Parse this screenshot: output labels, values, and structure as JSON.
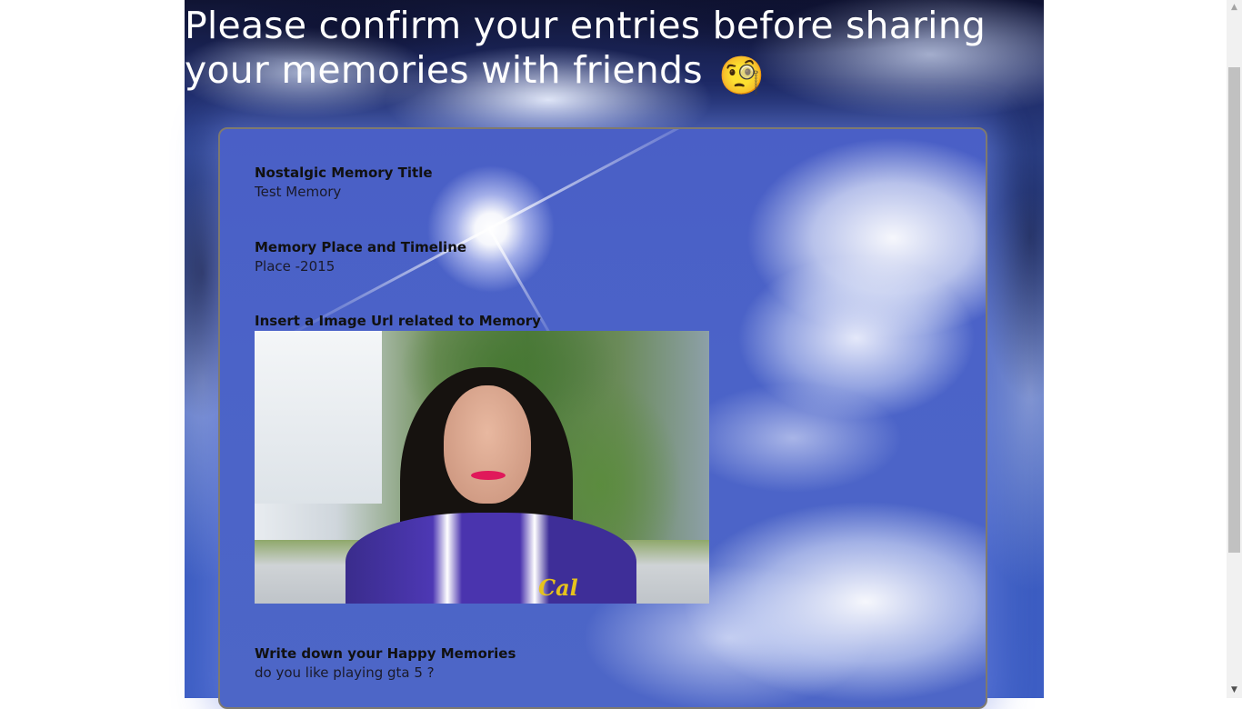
{
  "page": {
    "title": "Please confirm your entries before sharing your memories with friends",
    "title_emoji": "🧐"
  },
  "memory": {
    "title_label": "Nostalgic Memory Title",
    "title_value": "Test Memory",
    "place_label": "Memory Place and Timeline",
    "place_value": "Place -2015",
    "image_label": "Insert a Image Url related to Memory",
    "image_alt": "Memory photo",
    "image_caption_logo": "Cal",
    "happy_label": "Write down your Happy Memories",
    "happy_value": "do you like playing gta 5 ?"
  },
  "colors": {
    "card_border": "#7f7a6f",
    "sky_blue": "#4b63c8",
    "title_text": "#ffffff"
  },
  "scrollbar": {
    "up_icon": "triangle-up-icon",
    "down_icon": "triangle-down-icon"
  }
}
